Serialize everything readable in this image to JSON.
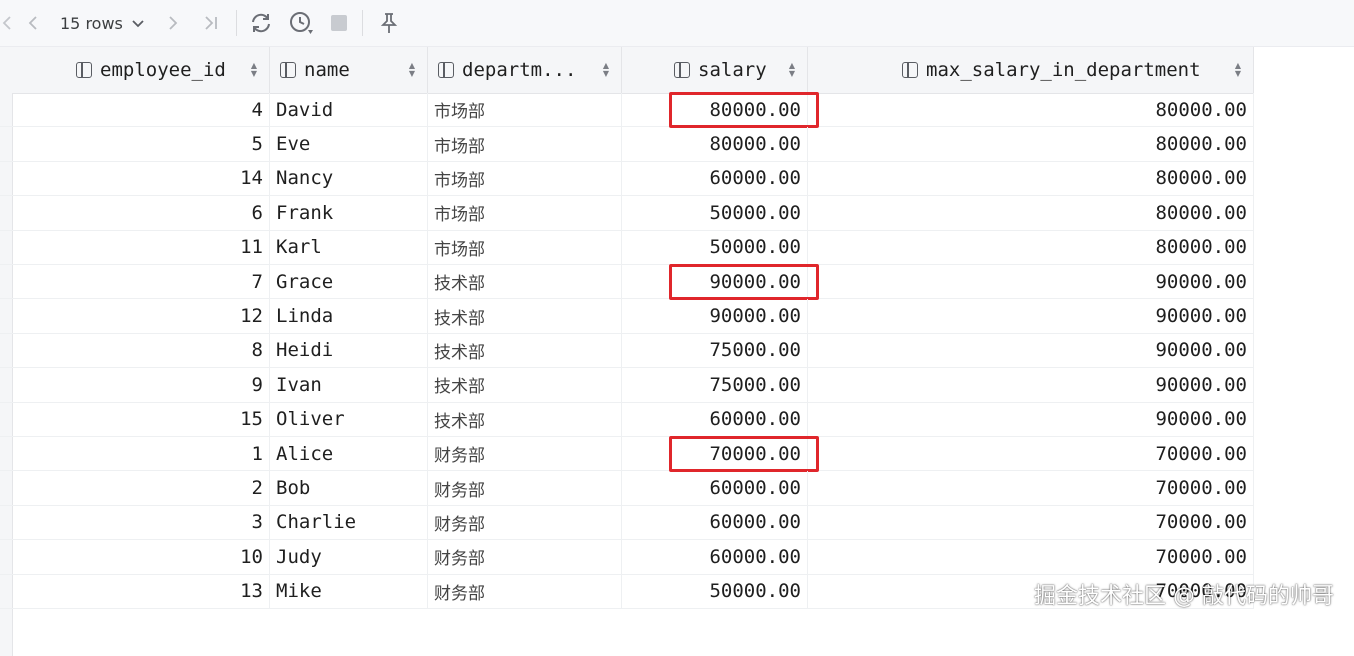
{
  "toolbar": {
    "rows_label": "15 rows",
    "icons": [
      "first-page-icon",
      "prev-page-icon",
      "next-page-icon",
      "last-page-icon",
      "refresh-icon",
      "history-icon",
      "stop-icon",
      "pin-icon"
    ]
  },
  "columns": [
    {
      "label": "employee_id"
    },
    {
      "label": "name"
    },
    {
      "label": "departm..."
    },
    {
      "label": "salary"
    },
    {
      "label": "max_salary_in_department"
    }
  ],
  "rows": [
    {
      "employee_id": "4",
      "name": "David",
      "department": "市场部",
      "salary": "80000.00",
      "max_salary": "80000.00",
      "highlight": true
    },
    {
      "employee_id": "5",
      "name": "Eve",
      "department": "市场部",
      "salary": "80000.00",
      "max_salary": "80000.00",
      "highlight": false
    },
    {
      "employee_id": "14",
      "name": "Nancy",
      "department": "市场部",
      "salary": "60000.00",
      "max_salary": "80000.00",
      "highlight": false
    },
    {
      "employee_id": "6",
      "name": "Frank",
      "department": "市场部",
      "salary": "50000.00",
      "max_salary": "80000.00",
      "highlight": false
    },
    {
      "employee_id": "11",
      "name": "Karl",
      "department": "市场部",
      "salary": "50000.00",
      "max_salary": "80000.00",
      "highlight": false
    },
    {
      "employee_id": "7",
      "name": "Grace",
      "department": "技术部",
      "salary": "90000.00",
      "max_salary": "90000.00",
      "highlight": true
    },
    {
      "employee_id": "12",
      "name": "Linda",
      "department": "技术部",
      "salary": "90000.00",
      "max_salary": "90000.00",
      "highlight": false
    },
    {
      "employee_id": "8",
      "name": "Heidi",
      "department": "技术部",
      "salary": "75000.00",
      "max_salary": "90000.00",
      "highlight": false
    },
    {
      "employee_id": "9",
      "name": "Ivan",
      "department": "技术部",
      "salary": "75000.00",
      "max_salary": "90000.00",
      "highlight": false
    },
    {
      "employee_id": "15",
      "name": "Oliver",
      "department": "技术部",
      "salary": "60000.00",
      "max_salary": "90000.00",
      "highlight": false
    },
    {
      "employee_id": "1",
      "name": "Alice",
      "department": "财务部",
      "salary": "70000.00",
      "max_salary": "70000.00",
      "highlight": true
    },
    {
      "employee_id": "2",
      "name": "Bob",
      "department": "财务部",
      "salary": "60000.00",
      "max_salary": "70000.00",
      "highlight": false
    },
    {
      "employee_id": "3",
      "name": "Charlie",
      "department": "财务部",
      "salary": "60000.00",
      "max_salary": "70000.00",
      "highlight": false
    },
    {
      "employee_id": "10",
      "name": "Judy",
      "department": "财务部",
      "salary": "60000.00",
      "max_salary": "70000.00",
      "highlight": false
    },
    {
      "employee_id": "13",
      "name": "Mike",
      "department": "财务部",
      "salary": "50000.00",
      "max_salary": "70000.00",
      "highlight": false
    }
  ],
  "colors": {
    "highlight_border": "#e0262b",
    "header_bg": "#f5f6f8",
    "toolbar_bg": "#f7f8fa"
  },
  "watermark": "掘金技术社区 @ 敲代码的帅哥"
}
